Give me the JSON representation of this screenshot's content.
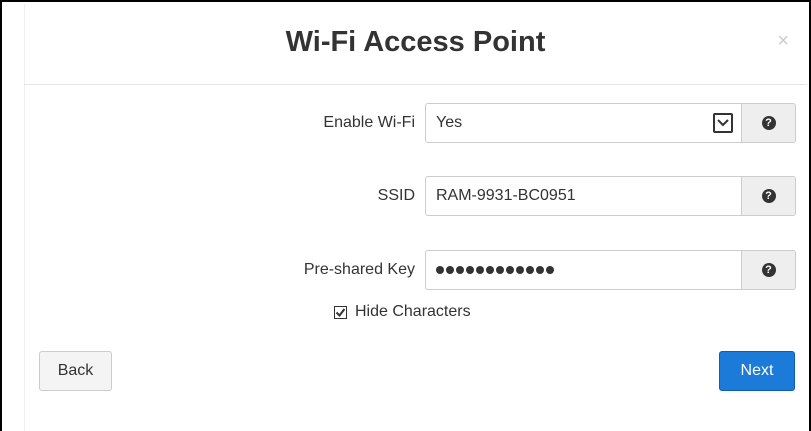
{
  "modal": {
    "title": "Wi-Fi Access Point",
    "close_symbol": "×"
  },
  "form": {
    "enable_wifi": {
      "label": "Enable Wi-Fi",
      "value": "Yes",
      "help_icon": "question-circle-icon"
    },
    "ssid": {
      "label": "SSID",
      "value": "RAM-9931-BC0951",
      "help_icon": "question-circle-icon"
    },
    "psk": {
      "label": "Pre-shared Key",
      "masked_length": 12,
      "help_icon": "question-circle-icon"
    },
    "hide_characters": {
      "label": "Hide Characters",
      "checked": true
    }
  },
  "buttons": {
    "back_label": "Back",
    "next_label": "Next"
  },
  "colors": {
    "next_button": "#1c7ad8",
    "addon_background": "#eeeeee"
  }
}
